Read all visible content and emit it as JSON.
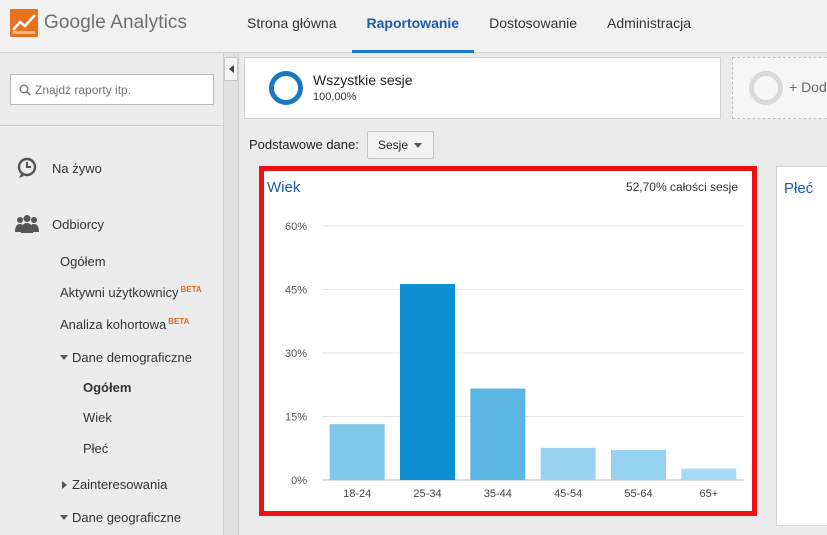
{
  "app": {
    "logo_text": "Google Analytics"
  },
  "nav": {
    "items": [
      {
        "label": "Strona główna",
        "active": false
      },
      {
        "label": "Raportowanie",
        "active": true
      },
      {
        "label": "Dostosowanie",
        "active": false
      },
      {
        "label": "Administracja",
        "active": false
      }
    ]
  },
  "sidebar": {
    "search_placeholder": "Znajdź raporty itp.",
    "live_label": "Na żywo",
    "audience_label": "Odbiorcy",
    "items": [
      {
        "label": "Ogółem"
      },
      {
        "label": "Aktywni użytkownicy",
        "badge": "BETA"
      },
      {
        "label": "Analiza kohortowa",
        "badge": "BETA"
      },
      {
        "label": "Dane demograficzne",
        "expanded": true
      },
      {
        "label": "Ogółem",
        "selected": true
      },
      {
        "label": "Wiek"
      },
      {
        "label": "Płeć"
      },
      {
        "label": "Zainteresowania",
        "expanded": false
      },
      {
        "label": "Dane geograficzne",
        "expanded": true
      }
    ]
  },
  "segment": {
    "title": "Wszystkie sesje",
    "percent": "100,00%",
    "add_label": "+ Dod"
  },
  "primary_dimension": {
    "label": "Podstawowe dane:",
    "selected": "Sesje"
  },
  "age_card": {
    "title": "Wiek",
    "total_note": "52,70% całości sesje"
  },
  "gender_card": {
    "title": "Płeć"
  },
  "colors": {
    "accent": "#1a5ea8",
    "highlight_border": "#ee1111",
    "bar_highlight": "#0b8fd0",
    "bar_default": "#7ec8ea"
  },
  "chart_data": {
    "type": "bar",
    "categories": [
      "18-24",
      "25-34",
      "35-44",
      "45-54",
      "55-64",
      "65+"
    ],
    "values": [
      13.2,
      46.3,
      21.6,
      7.6,
      7.1,
      2.7
    ],
    "bar_colors": [
      "#7ec8ea",
      "#0b8fd0",
      "#5cb6e2",
      "#9ad5f0",
      "#94d2ef",
      "#a6dbf3"
    ],
    "title": "Wiek",
    "ylim": [
      0,
      60
    ],
    "yticks": [
      "0%",
      "15%",
      "30%",
      "45%",
      "60%"
    ],
    "ytick_values": [
      0,
      15,
      30,
      45,
      60
    ],
    "grid": true
  }
}
